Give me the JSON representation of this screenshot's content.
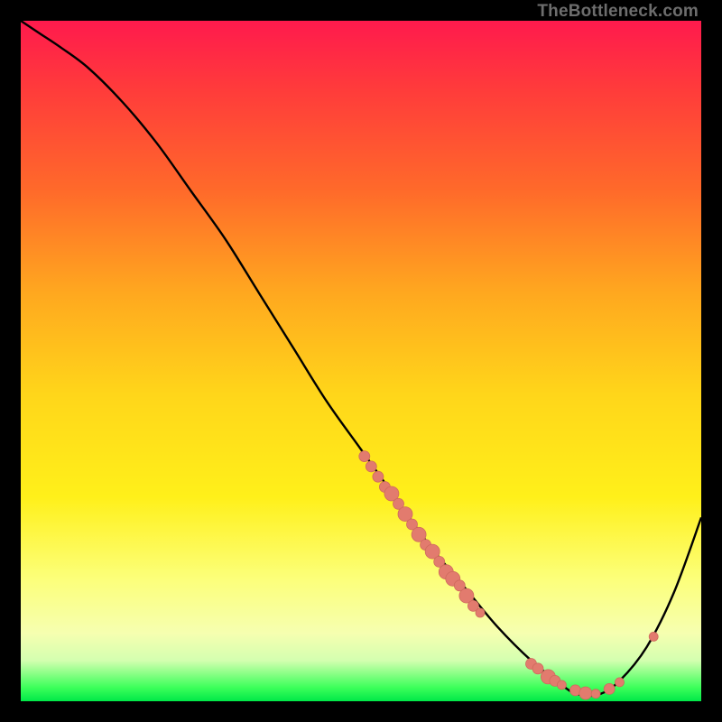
{
  "attribution": "TheBottleneck.com",
  "colors": {
    "background": "#000000",
    "curve": "#000000",
    "marker_fill": "#e27b6e",
    "marker_stroke": "#cf6a5d",
    "gradient_stops": [
      "#ff1a4d",
      "#ff3b3b",
      "#ff6a2a",
      "#ffa81f",
      "#ffd61a",
      "#fff01a",
      "#fcff7a",
      "#f6ffb0",
      "#d4ffb0",
      "#3cff5a",
      "#00e848"
    ]
  },
  "chart_data": {
    "type": "line",
    "title": "",
    "xlabel": "",
    "ylabel": "",
    "xlim": [
      0,
      100
    ],
    "ylim": [
      0,
      100
    ],
    "grid": false,
    "legend": false,
    "series": [
      {
        "name": "curve",
        "x": [
          0,
          3,
          6,
          10,
          15,
          20,
          25,
          30,
          35,
          40,
          45,
          50,
          55,
          60,
          65,
          70,
          75,
          80,
          82,
          85,
          88,
          92,
          96,
          100
        ],
        "y": [
          100,
          98,
          96,
          93,
          88,
          82,
          75,
          68,
          60,
          52,
          44,
          37,
          30,
          23,
          17,
          11,
          6,
          2,
          1,
          1,
          3,
          8,
          16,
          27
        ]
      }
    ],
    "markers": [
      {
        "x": 50.5,
        "y": 36.0,
        "r": 6
      },
      {
        "x": 51.5,
        "y": 34.5,
        "r": 6
      },
      {
        "x": 52.5,
        "y": 33.0,
        "r": 6
      },
      {
        "x": 53.5,
        "y": 31.5,
        "r": 6
      },
      {
        "x": 54.5,
        "y": 30.5,
        "r": 8
      },
      {
        "x": 55.5,
        "y": 29.0,
        "r": 6
      },
      {
        "x": 56.5,
        "y": 27.5,
        "r": 8
      },
      {
        "x": 57.5,
        "y": 26.0,
        "r": 6
      },
      {
        "x": 58.5,
        "y": 24.5,
        "r": 8
      },
      {
        "x": 59.5,
        "y": 23.0,
        "r": 6
      },
      {
        "x": 60.5,
        "y": 22.0,
        "r": 8
      },
      {
        "x": 61.5,
        "y": 20.5,
        "r": 6
      },
      {
        "x": 62.5,
        "y": 19.0,
        "r": 8
      },
      {
        "x": 63.5,
        "y": 18.0,
        "r": 8
      },
      {
        "x": 64.5,
        "y": 17.0,
        "r": 6
      },
      {
        "x": 65.5,
        "y": 15.5,
        "r": 8
      },
      {
        "x": 66.5,
        "y": 14.0,
        "r": 6
      },
      {
        "x": 67.5,
        "y": 13.0,
        "r": 5
      },
      {
        "x": 75.0,
        "y": 5.5,
        "r": 6
      },
      {
        "x": 76.0,
        "y": 4.8,
        "r": 6
      },
      {
        "x": 77.5,
        "y": 3.6,
        "r": 8
      },
      {
        "x": 78.5,
        "y": 3.0,
        "r": 6
      },
      {
        "x": 79.5,
        "y": 2.4,
        "r": 5
      },
      {
        "x": 81.5,
        "y": 1.6,
        "r": 6
      },
      {
        "x": 83.0,
        "y": 1.2,
        "r": 7
      },
      {
        "x": 84.5,
        "y": 1.1,
        "r": 5
      },
      {
        "x": 86.5,
        "y": 1.8,
        "r": 6
      },
      {
        "x": 88.0,
        "y": 2.8,
        "r": 5
      },
      {
        "x": 93.0,
        "y": 9.5,
        "r": 5
      }
    ]
  }
}
